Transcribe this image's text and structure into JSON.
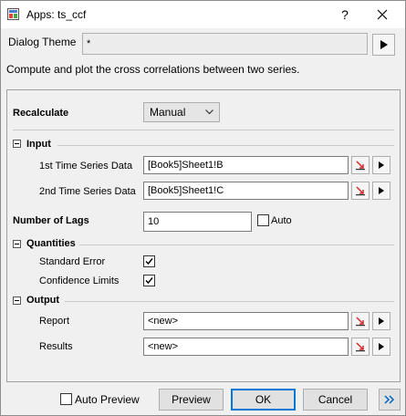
{
  "window": {
    "title": "Apps: ts_ccf",
    "help_label": "?"
  },
  "theme": {
    "label": "Dialog Theme",
    "value": "*"
  },
  "description": "Compute and plot the cross correlations between two series.",
  "recalculate": {
    "label": "Recalculate",
    "value": "Manual"
  },
  "input": {
    "section_label": "Input",
    "series1": {
      "label": "1st Time Series Data",
      "value": "[Book5]Sheet1!B"
    },
    "series2": {
      "label": "2nd Time Series Data",
      "value": "[Book5]Sheet1!C"
    }
  },
  "lags": {
    "label": "Number of Lags",
    "value": "10",
    "auto_label": "Auto",
    "auto_checked": false
  },
  "quantities": {
    "section_label": "Quantities",
    "std_error": {
      "label": "Standard Error",
      "checked": true
    },
    "conf_limits": {
      "label": "Confidence Limits",
      "checked": true
    }
  },
  "output": {
    "section_label": "Output",
    "report": {
      "label": "Report",
      "value": "<new>"
    },
    "results": {
      "label": "Results",
      "value": "<new>"
    }
  },
  "footer": {
    "auto_preview_label": "Auto Preview",
    "preview_label": "Preview",
    "ok_label": "OK",
    "cancel_label": "Cancel"
  },
  "colors": {
    "accent": "#0078d7",
    "background": "#f0f0f0",
    "red_arrow": "#d42b2b"
  }
}
